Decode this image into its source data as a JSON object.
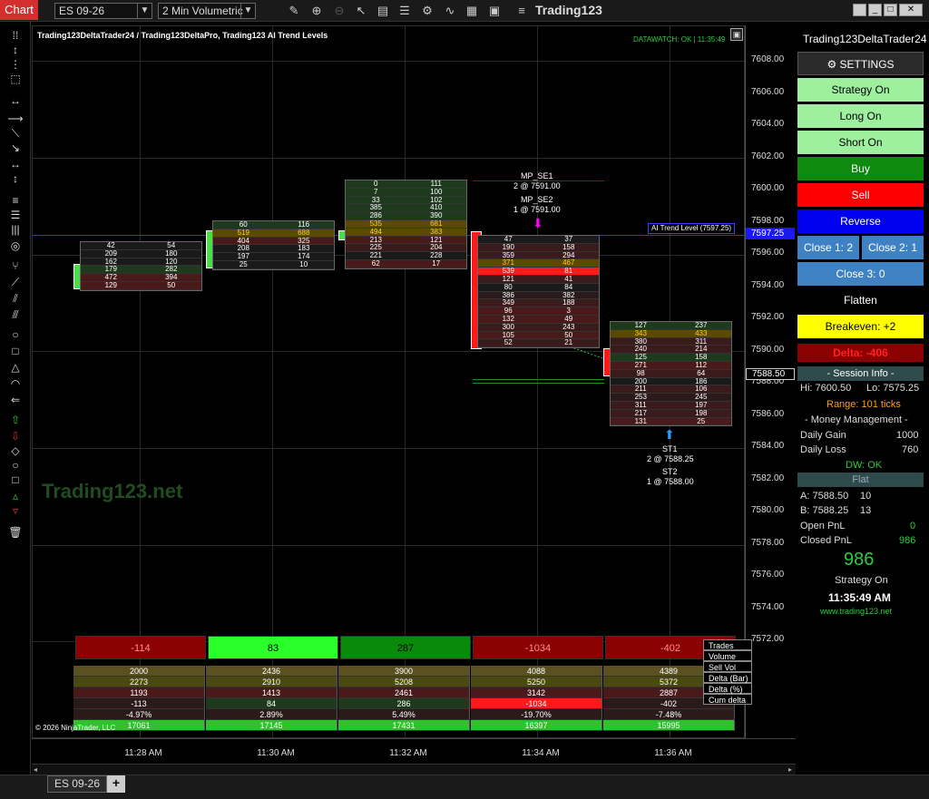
{
  "toolbar": {
    "chart_tab": "Chart",
    "instrument": "ES 09-26",
    "period": "2 Min Volumetric",
    "app_title": "Trading123"
  },
  "chart": {
    "title": "Trading123DeltaTrader24 / Trading123DeltaPro, Trading123 AI Trend Levels",
    "datawatch": "DATAWATCH: OK | 11:35:49",
    "watermark": "Trading123.net",
    "copyright": "© 2026 NinjaTrader, LLC",
    "trend_level_label": "AI Trend Level (7597.25)",
    "trend_level_price": "7597.25",
    "last_price": "7588.50",
    "annotations": {
      "mp_se1": "MP_SE1",
      "mp_se1_detail": "2 @ 7591.00",
      "mp_se2": "MP_SE2",
      "mp_se2_detail": "1 @ 7591.00",
      "st1": "ST1",
      "st1_detail": "2 @ 7588.25",
      "st2": "ST2",
      "st2_detail": "1 @ 7588.00"
    },
    "price_ticks": [
      "7608.00",
      "7606.00",
      "7604.00",
      "7602.00",
      "7600.00",
      "7598.00",
      "7596.00",
      "7594.00",
      "7592.00",
      "7590.00",
      "7588.00",
      "7586.00",
      "7584.00",
      "7582.00",
      "7580.00",
      "7578.00",
      "7576.00",
      "7574.00",
      "7572.00"
    ],
    "time_ticks": [
      "11:28 AM",
      "11:30 AM",
      "11:32 AM",
      "11:34 AM",
      "11:36 AM"
    ],
    "bars": [
      {
        "rows": [
          [
            "42",
            "54"
          ],
          [
            "209",
            "180"
          ],
          [
            "162",
            "120"
          ],
          [
            "179",
            "282"
          ],
          [
            "472",
            "394"
          ],
          [
            "129",
            "50"
          ]
        ]
      },
      {
        "rows": [
          [
            "60",
            "116"
          ],
          [
            "519",
            "688"
          ],
          [
            "404",
            "325"
          ],
          [
            "208",
            "183"
          ],
          [
            "197",
            "174"
          ],
          [
            "25",
            "10"
          ]
        ]
      },
      {
        "rows": [
          [
            "0",
            "111"
          ],
          [
            "7",
            "100"
          ],
          [
            "33",
            "102"
          ],
          [
            "385",
            "410"
          ],
          [
            "286",
            "390"
          ],
          [
            "535",
            "681"
          ],
          [
            "494",
            "383"
          ],
          [
            "213",
            "121"
          ],
          [
            "225",
            "204"
          ],
          [
            "221",
            "228"
          ],
          [
            "62",
            "17"
          ]
        ]
      },
      {
        "rows": [
          [
            "47",
            "37"
          ],
          [
            "190",
            "158"
          ],
          [
            "359",
            "294"
          ],
          [
            "371",
            "467"
          ],
          [
            "539",
            "81"
          ],
          [
            "121",
            "41"
          ],
          [
            "80",
            "84"
          ],
          [
            "386",
            "382"
          ],
          [
            "349",
            "188"
          ],
          [
            "96",
            "3"
          ],
          [
            "132",
            "49"
          ],
          [
            "300",
            "243"
          ],
          [
            "105",
            "50"
          ],
          [
            "52",
            "21"
          ]
        ]
      },
      {
        "rows": [
          [
            "127",
            "237"
          ],
          [
            "343",
            "433"
          ],
          [
            "380",
            "311"
          ],
          [
            "240",
            "214"
          ],
          [
            "125",
            "158"
          ],
          [
            "271",
            "112"
          ],
          [
            "98",
            "64"
          ],
          [
            "200",
            "186"
          ],
          [
            "211",
            "106"
          ],
          [
            "253",
            "245"
          ],
          [
            "311",
            "197"
          ],
          [
            "217",
            "198"
          ],
          [
            "131",
            "25"
          ]
        ]
      }
    ],
    "delta_boxes": [
      "-114",
      "83",
      "287",
      "-1034",
      "-402"
    ],
    "stats": {
      "labels": [
        "Trades",
        "Volume",
        "Sell Vol",
        "Delta (Bar)",
        "Delta (%)",
        "Cum delta"
      ],
      "columns": [
        [
          "2000",
          "2273",
          "1193",
          "-113",
          "-4.97%",
          "17061"
        ],
        [
          "2436",
          "2910",
          "1413",
          "84",
          "2.89%",
          "17145"
        ],
        [
          "3900",
          "5208",
          "2461",
          "286",
          "5.49%",
          "17431"
        ],
        [
          "4088",
          "5250",
          "3142",
          "-1034",
          "-19.70%",
          "16397"
        ],
        [
          "4389",
          "5372",
          "2887",
          "-402",
          "-7.48%",
          "15995"
        ]
      ]
    }
  },
  "panel": {
    "title": "Trading123DeltaTrader24",
    "settings": "SETTINGS",
    "strategy_on": "Strategy On",
    "long_on": "Long On",
    "short_on": "Short On",
    "buy": "Buy",
    "sell": "Sell",
    "reverse": "Reverse",
    "close1": "Close 1: 2",
    "close2": "Close 2: 1",
    "close3": "Close 3: 0",
    "flatten": "Flatten",
    "breakeven": "Breakeven: +2",
    "delta": "Delta: -406",
    "session_info": "- Session Info -",
    "hi": "Hi: 7600.50",
    "lo": "Lo: 7575.25",
    "range": "Range: 101 ticks",
    "money_mgmt": "- Money Management -",
    "daily_gain_lbl": "Daily Gain",
    "daily_gain_val": "1000",
    "daily_loss_lbl": "Daily Loss",
    "daily_loss_val": "760",
    "dw": "DW: OK",
    "flat": "Flat",
    "ask": "A: 7588.50",
    "ask_size": "10",
    "bid": "B: 7588.25",
    "bid_size": "13",
    "open_pnl_lbl": "Open PnL",
    "open_pnl_val": "0",
    "closed_pnl_lbl": "Closed PnL",
    "closed_pnl_val": "986",
    "big_pnl": "986",
    "status": "Strategy On",
    "clock": "11:35:49 AM",
    "website": "www.trading123.net"
  },
  "bottom": {
    "tab": "ES 09-26",
    "add": "+"
  }
}
